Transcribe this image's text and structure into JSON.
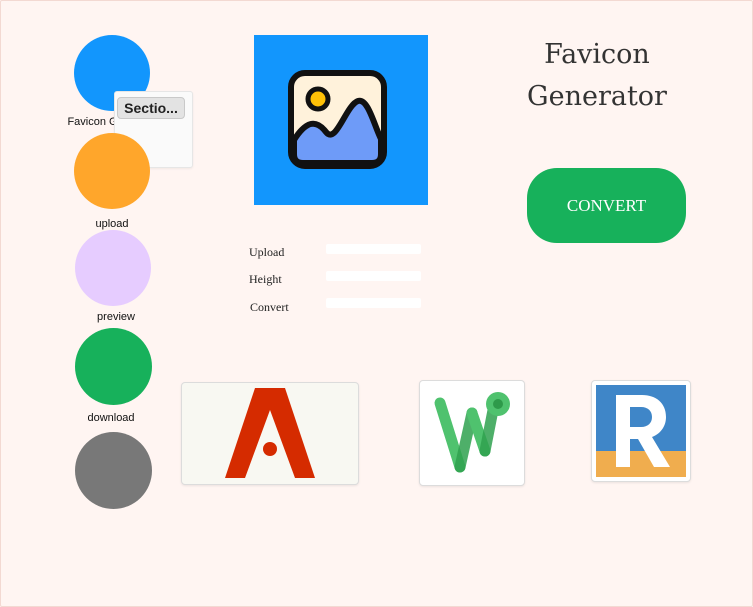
{
  "app": {
    "title": "Favicon Generator"
  },
  "sidebar": {
    "items": [
      {
        "label": "Favicon Generator",
        "color": "#1296fd"
      },
      {
        "label": "upload",
        "color": "#ffa62b"
      },
      {
        "label": "preview",
        "color": "#e6ccff"
      },
      {
        "label": "download",
        "color": "#17b15b"
      },
      {
        "label": "",
        "color": "#787878"
      }
    ],
    "section_button": "Sectio..."
  },
  "preview": {
    "icon": "image-icon",
    "background": "#1296fd"
  },
  "actions": {
    "convert_label": "CONVERT"
  },
  "form": {
    "fields": [
      {
        "label": "Upload",
        "value": ""
      },
      {
        "label": "Height",
        "value": ""
      },
      {
        "label": "Convert",
        "value": ""
      }
    ]
  },
  "logos": [
    {
      "icon": "letter-a-logo-icon"
    },
    {
      "icon": "letter-w-logo-icon"
    },
    {
      "icon": "letter-r-logo-icon"
    }
  ]
}
